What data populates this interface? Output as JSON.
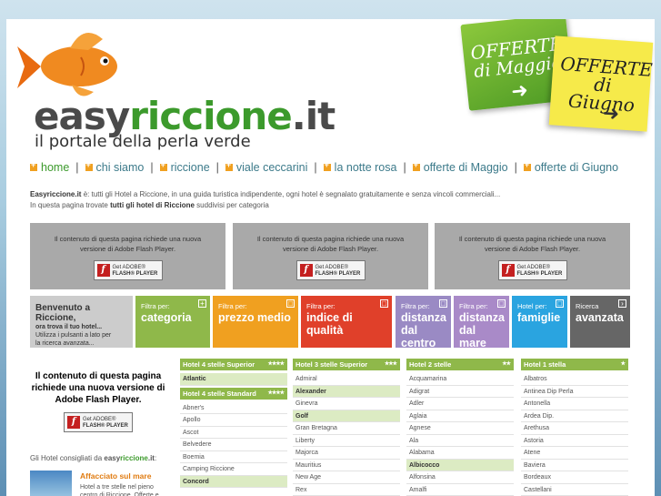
{
  "header": {
    "logo_part1": "easy",
    "logo_part2": "riccione",
    "logo_part3": ".it",
    "tagline": "il portale della perla verde"
  },
  "offers": [
    {
      "line1": "OFFERTE",
      "line2": "di Maggio",
      "arrow": "➜"
    },
    {
      "line1": "OFFERTE",
      "line2": "di Giugno",
      "arrow": "➜"
    }
  ],
  "nav": [
    {
      "label": "home",
      "active": true
    },
    {
      "label": "chi siamo"
    },
    {
      "label": "riccione"
    },
    {
      "label": "viale ceccarini"
    },
    {
      "label": "la notte rosa"
    },
    {
      "label": "offerte di Maggio"
    },
    {
      "label": "offerte di Giugno"
    }
  ],
  "intro": {
    "brand": "Easyriccione.it",
    "text1": " è: tutti gli Hotel a Riccione, in una guida turistica indipendente, ogni hotel è segnalato gratuitamente e senza vincoli commerciali...",
    "text2a": "In questa pagina trovate ",
    "text2b": "tutti gli hotel di Riccione",
    "text2c": " suddivisi per categoria"
  },
  "flash": {
    "line1": "Il contenuto di questa pagina richiede una nuova",
    "line2": "versione di Adobe Flash Player.",
    "btn_small": "Get ADOBE®",
    "btn_big": "FLASH® PLAYER",
    "left_text": "Il contenuto di questa pagina richiede una nuova versione di Adobe Flash Player."
  },
  "welcome": {
    "title": "Benvenuto a Riccione,",
    "sub1": "ora trova il tuo hotel...",
    "sub2": "Utilizza i pulsanti a lato per",
    "sub3": "la ricerca avanzata..."
  },
  "filters": [
    {
      "small": "Filtra per:",
      "big": "categoria",
      "color": "#8fb84a",
      "pm": "+"
    },
    {
      "small": "Filtra per:",
      "big": "prezzo medio",
      "color": "#f0a020",
      "pm": "□"
    },
    {
      "small": "Filtra per:",
      "big": "indice di qualità",
      "color": "#e0402a",
      "pm": "□"
    },
    {
      "small": "Filtra per:",
      "big": "distanza dal centro",
      "color": "#9a8ac4",
      "pm": "□"
    },
    {
      "small": "Filtra per:",
      "big": "distanza dal mare",
      "color": "#a98ac8",
      "pm": "□"
    },
    {
      "small": "Hotel per:",
      "big": "famiglie",
      "color": "#2aa4e0",
      "pm": "□"
    },
    {
      "small": "Ricerca",
      "big": "avanzata",
      "color": "#666666",
      "pm": "›"
    }
  ],
  "consigliati": {
    "text": "Gli Hotel consigliati da ",
    "brand1": "easy",
    "brand2": "riccione",
    "brand3": ".it",
    ":": ":"
  },
  "featured": {
    "name": "Affacciato sul mare",
    "desc": "Hotel a tre stelle nel pieno centro di Riccione. Offerte e"
  },
  "columns": [
    {
      "groups": [
        {
          "title": "Hotel 4 stelle Superior",
          "stars": "★★★★",
          "items": [
            {
              "n": "Atlantic",
              "hl": true
            }
          ]
        },
        {
          "title": "Hotel 4 stelle Standard",
          "stars": "★★★★",
          "items": [
            {
              "n": "Abner's"
            },
            {
              "n": "Apollo"
            },
            {
              "n": "Ascot"
            },
            {
              "n": "Belvedere"
            },
            {
              "n": "Boemia"
            },
            {
              "n": "Camping Riccione"
            },
            {
              "n": "Concord",
              "hl": true
            }
          ]
        }
      ]
    },
    {
      "groups": [
        {
          "title": "Hotel 3 stelle Superior",
          "stars": "★★★",
          "items": [
            {
              "n": "Admiral"
            },
            {
              "n": "Alexander",
              "hl": true
            },
            {
              "n": "Ginevra"
            },
            {
              "n": "Golf",
              "hl": true
            },
            {
              "n": "Gran Bretagna"
            },
            {
              "n": "Liberty"
            },
            {
              "n": "Majorca"
            },
            {
              "n": "Mauritius"
            },
            {
              "n": "New Age"
            },
            {
              "n": "Rex"
            }
          ]
        }
      ]
    },
    {
      "groups": [
        {
          "title": "Hotel 2 stelle",
          "stars": "★★",
          "items": [
            {
              "n": "Acquamarina"
            },
            {
              "n": "Adigrat"
            },
            {
              "n": "Adler"
            },
            {
              "n": "Aglaia"
            },
            {
              "n": "Agnese"
            },
            {
              "n": "Ala"
            },
            {
              "n": "Alabama"
            },
            {
              "n": "Albicocco",
              "hl": true
            },
            {
              "n": "Alfonsina"
            },
            {
              "n": "Amalfi"
            }
          ]
        }
      ]
    },
    {
      "groups": [
        {
          "title": "Hotel 1 stella",
          "stars": "★",
          "items": [
            {
              "n": "Albatros"
            },
            {
              "n": "Antinea Dip Perla"
            },
            {
              "n": "Antonella"
            },
            {
              "n": "Ardea Dip."
            },
            {
              "n": "Arethusa"
            },
            {
              "n": "Astoria"
            },
            {
              "n": "Atene"
            },
            {
              "n": "Baviera"
            },
            {
              "n": "Bordeaux"
            },
            {
              "n": "Castellani"
            }
          ]
        }
      ]
    }
  ]
}
